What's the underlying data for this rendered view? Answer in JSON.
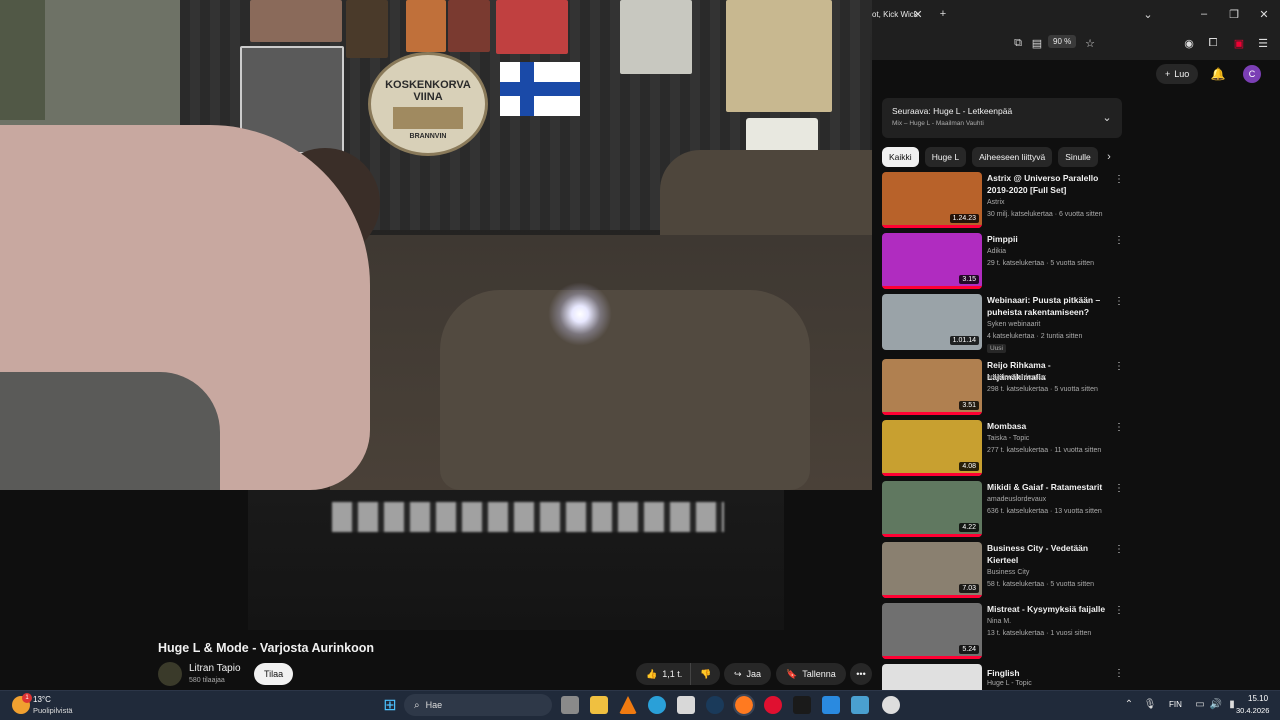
{
  "browser": {
    "tab_title": "ot, Kick Wick",
    "zoom": "90 %",
    "accent": "#1f1f1f"
  },
  "youtube": {
    "create_label": "Luo",
    "avatar_letter": "C",
    "video": {
      "title": "Huge L & Mode - Varjosta Aurinkoon",
      "channel": "Litran Tapio",
      "subscribers": "580 tilaajaa",
      "subscribe_label": "Tilaa",
      "likes": "1,1 t.",
      "share_label": "Jaa",
      "save_label": "Tallenna",
      "poster_text_1": "KOSKENKORVA",
      "poster_text_2": "VIINA",
      "poster_text_3": "BRANNVIN"
    },
    "up_next": {
      "title": "Seuraava: Huge L - Letkeenpää",
      "subtitle": "Mix – Huge L - Maailman Vauhti"
    },
    "chips": [
      "Kaikki",
      "Huge L",
      "Aiheeseen liittyvä",
      "Sinulle"
    ],
    "recommendations": [
      {
        "title": "Astrix @ Universo Paralello 2019-2020 [Full Set]",
        "channel": "Astrix",
        "meta": "30 milj. katselukertaa · 6 vuotta sitten",
        "duration": "1.24.23",
        "color": "#b8622a"
      },
      {
        "title": "Pimppii",
        "channel": "Adikia",
        "meta": "29 t. katselukertaa · 5 vuotta sitten",
        "duration": "3.15",
        "color": "#b02cc0"
      },
      {
        "title": "Webinaari: Puusta pitkään – puheista rakentamiseen?",
        "channel": "Syken webinaarit",
        "meta": "4 katselukertaa · 2 tuntia sitten",
        "duration": "1.01.14",
        "badge": "Uusi",
        "color": "#9aa3a8"
      },
      {
        "title": "Reijo Rihkama - Läjämäkimafia",
        "channel": "amadeuslordevaux",
        "meta": "298 t. katselukertaa · 5 vuotta sitten",
        "duration": "3.51",
        "color": "#b08050"
      },
      {
        "title": "Mombasa",
        "channel": "Taiska - Topic",
        "meta": "277 t. katselukertaa · 11 vuotta sitten",
        "duration": "4.08",
        "color": "#c8a030"
      },
      {
        "title": "Mikidi & Gaiaf - Ratamestarit",
        "channel": "amadeuslordevaux",
        "meta": "636 t. katselukertaa · 13 vuotta sitten",
        "duration": "4.22",
        "color": "#607860"
      },
      {
        "title": "Business City - Vedetään Kierteel",
        "channel": "Business City",
        "meta": "58 t. katselukertaa · 5 vuotta sitten",
        "duration": "7.03",
        "color": "#8a8070"
      },
      {
        "title": "Mistreat - Kysymyksiä faijalle",
        "channel": "Nina M.",
        "meta": "13 t. katselukertaa · 1 vuosi sitten",
        "duration": "5.24",
        "color": "#707070"
      },
      {
        "title": "Finglish",
        "channel": "Huge L - Topic",
        "meta": "",
        "duration": "",
        "color": "#e0e0e0"
      }
    ]
  },
  "taskbar": {
    "temperature": "13°C",
    "weather": "Puolipilvistä",
    "search_placeholder": "Hae",
    "language": "FIN",
    "time": "15.10",
    "date": "30.4.2026",
    "weather_badge": "1"
  }
}
